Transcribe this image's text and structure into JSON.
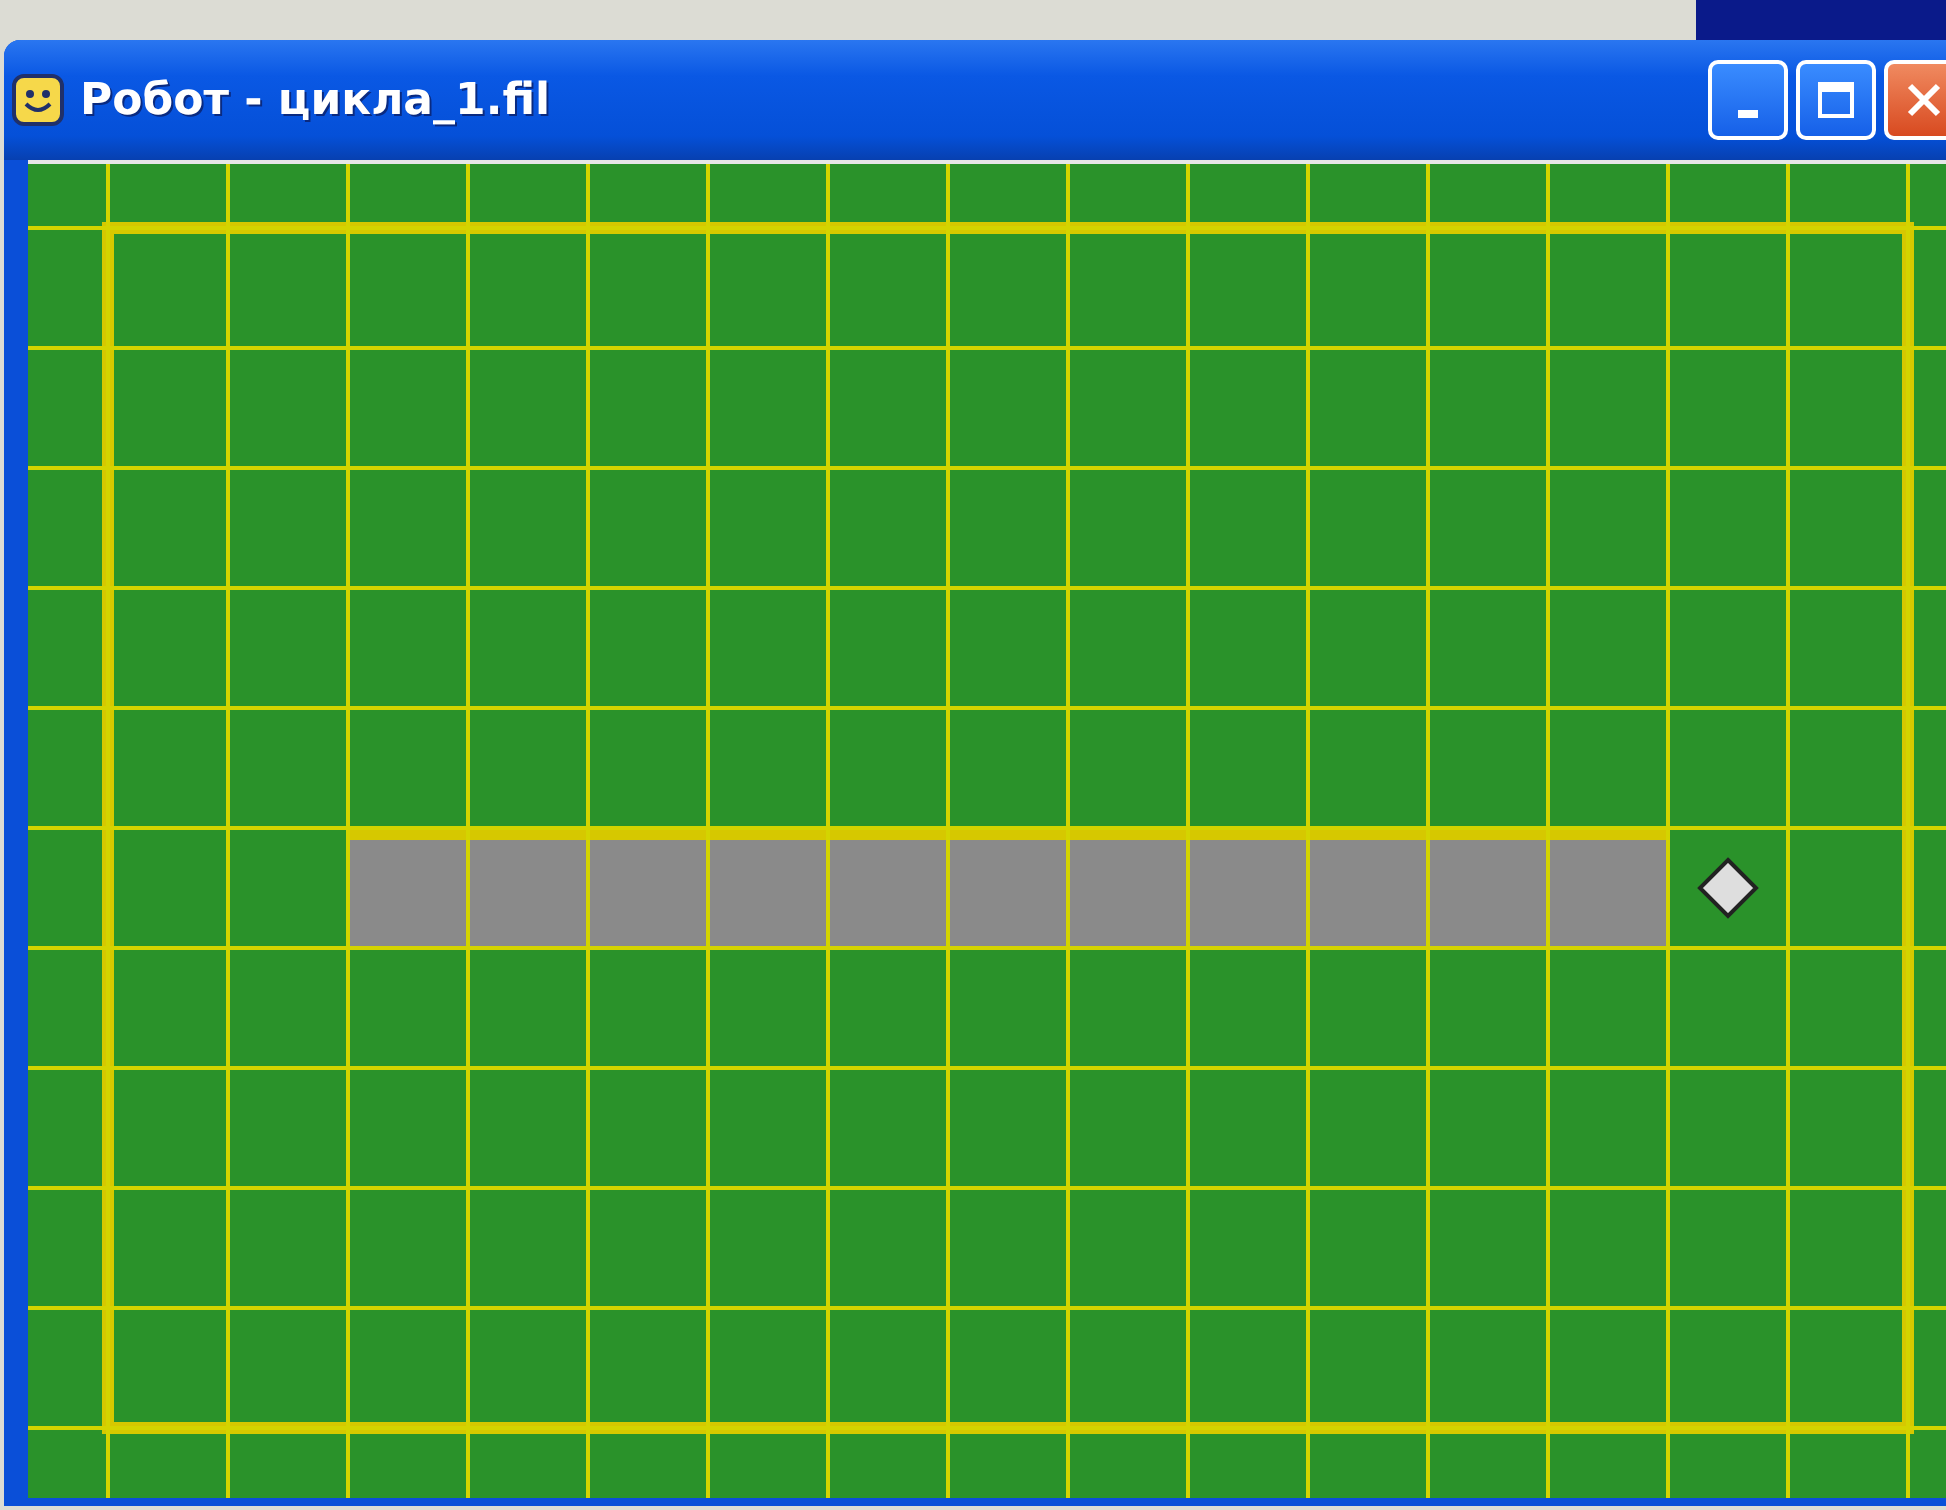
{
  "window": {
    "title": "Робот - цикла_1.fil",
    "buttons": [
      {
        "kind": "minimize"
      },
      {
        "kind": "maximize"
      },
      {
        "kind": "close"
      }
    ]
  },
  "field": {
    "rows": [
      {
        "cells": [
          {
            "painted": false,
            "robot": false,
            "wall_top": false
          },
          {
            "painted": false,
            "robot": false,
            "wall_top": false
          },
          {
            "painted": false,
            "robot": false,
            "wall_top": false
          },
          {
            "painted": false,
            "robot": false,
            "wall_top": false
          },
          {
            "painted": false,
            "robot": false,
            "wall_top": false
          },
          {
            "painted": false,
            "robot": false,
            "wall_top": false
          },
          {
            "painted": false,
            "robot": false,
            "wall_top": false
          },
          {
            "painted": false,
            "robot": false,
            "wall_top": false
          },
          {
            "painted": false,
            "robot": false,
            "wall_top": false
          },
          {
            "painted": false,
            "robot": false,
            "wall_top": false
          },
          {
            "painted": false,
            "robot": false,
            "wall_top": false
          },
          {
            "painted": false,
            "robot": false,
            "wall_top": false
          },
          {
            "painted": false,
            "robot": false,
            "wall_top": false
          },
          {
            "painted": false,
            "robot": false,
            "wall_top": false
          },
          {
            "painted": false,
            "robot": false,
            "wall_top": false
          }
        ]
      },
      {
        "cells": [
          {
            "painted": false,
            "robot": false,
            "wall_top": false
          },
          {
            "painted": false,
            "robot": false,
            "wall_top": false
          },
          {
            "painted": false,
            "robot": false,
            "wall_top": false
          },
          {
            "painted": false,
            "robot": false,
            "wall_top": false
          },
          {
            "painted": false,
            "robot": false,
            "wall_top": false
          },
          {
            "painted": false,
            "robot": false,
            "wall_top": false
          },
          {
            "painted": false,
            "robot": false,
            "wall_top": false
          },
          {
            "painted": false,
            "robot": false,
            "wall_top": false
          },
          {
            "painted": false,
            "robot": false,
            "wall_top": false
          },
          {
            "painted": false,
            "robot": false,
            "wall_top": false
          },
          {
            "painted": false,
            "robot": false,
            "wall_top": false
          },
          {
            "painted": false,
            "robot": false,
            "wall_top": false
          },
          {
            "painted": false,
            "robot": false,
            "wall_top": false
          },
          {
            "painted": false,
            "robot": false,
            "wall_top": false
          },
          {
            "painted": false,
            "robot": false,
            "wall_top": false
          }
        ]
      },
      {
        "cells": [
          {
            "painted": false,
            "robot": false,
            "wall_top": false
          },
          {
            "painted": false,
            "robot": false,
            "wall_top": false
          },
          {
            "painted": false,
            "robot": false,
            "wall_top": false
          },
          {
            "painted": false,
            "robot": false,
            "wall_top": false
          },
          {
            "painted": false,
            "robot": false,
            "wall_top": false
          },
          {
            "painted": false,
            "robot": false,
            "wall_top": false
          },
          {
            "painted": false,
            "robot": false,
            "wall_top": false
          },
          {
            "painted": false,
            "robot": false,
            "wall_top": false
          },
          {
            "painted": false,
            "robot": false,
            "wall_top": false
          },
          {
            "painted": false,
            "robot": false,
            "wall_top": false
          },
          {
            "painted": false,
            "robot": false,
            "wall_top": false
          },
          {
            "painted": false,
            "robot": false,
            "wall_top": false
          },
          {
            "painted": false,
            "robot": false,
            "wall_top": false
          },
          {
            "painted": false,
            "robot": false,
            "wall_top": false
          },
          {
            "painted": false,
            "robot": false,
            "wall_top": false
          }
        ]
      },
      {
        "cells": [
          {
            "painted": false,
            "robot": false,
            "wall_top": false
          },
          {
            "painted": false,
            "robot": false,
            "wall_top": false
          },
          {
            "painted": false,
            "robot": false,
            "wall_top": false
          },
          {
            "painted": false,
            "robot": false,
            "wall_top": false
          },
          {
            "painted": false,
            "robot": false,
            "wall_top": false
          },
          {
            "painted": false,
            "robot": false,
            "wall_top": false
          },
          {
            "painted": false,
            "robot": false,
            "wall_top": false
          },
          {
            "painted": false,
            "robot": false,
            "wall_top": false
          },
          {
            "painted": false,
            "robot": false,
            "wall_top": false
          },
          {
            "painted": false,
            "robot": false,
            "wall_top": false
          },
          {
            "painted": false,
            "robot": false,
            "wall_top": false
          },
          {
            "painted": false,
            "robot": false,
            "wall_top": false
          },
          {
            "painted": false,
            "robot": false,
            "wall_top": false
          },
          {
            "painted": false,
            "robot": false,
            "wall_top": false
          },
          {
            "painted": false,
            "robot": false,
            "wall_top": false
          }
        ]
      },
      {
        "cells": [
          {
            "painted": false,
            "robot": false,
            "wall_top": false
          },
          {
            "painted": false,
            "robot": false,
            "wall_top": false
          },
          {
            "painted": false,
            "robot": false,
            "wall_top": false
          },
          {
            "painted": false,
            "robot": false,
            "wall_top": false
          },
          {
            "painted": false,
            "robot": false,
            "wall_top": false
          },
          {
            "painted": false,
            "robot": false,
            "wall_top": false
          },
          {
            "painted": false,
            "robot": false,
            "wall_top": false
          },
          {
            "painted": false,
            "robot": false,
            "wall_top": false
          },
          {
            "painted": false,
            "robot": false,
            "wall_top": false
          },
          {
            "painted": false,
            "robot": false,
            "wall_top": false
          },
          {
            "painted": false,
            "robot": false,
            "wall_top": false
          },
          {
            "painted": false,
            "robot": false,
            "wall_top": false
          },
          {
            "painted": false,
            "robot": false,
            "wall_top": false
          },
          {
            "painted": false,
            "robot": false,
            "wall_top": false
          },
          {
            "painted": false,
            "robot": false,
            "wall_top": false
          }
        ]
      },
      {
        "cells": [
          {
            "painted": false,
            "robot": false,
            "wall_top": false
          },
          {
            "painted": false,
            "robot": false,
            "wall_top": false
          },
          {
            "painted": true,
            "robot": false,
            "wall_top": true
          },
          {
            "painted": true,
            "robot": false,
            "wall_top": true
          },
          {
            "painted": true,
            "robot": false,
            "wall_top": true
          },
          {
            "painted": true,
            "robot": false,
            "wall_top": true
          },
          {
            "painted": true,
            "robot": false,
            "wall_top": true
          },
          {
            "painted": true,
            "robot": false,
            "wall_top": true
          },
          {
            "painted": true,
            "robot": false,
            "wall_top": true
          },
          {
            "painted": true,
            "robot": false,
            "wall_top": true
          },
          {
            "painted": true,
            "robot": false,
            "wall_top": true
          },
          {
            "painted": true,
            "robot": false,
            "wall_top": true
          },
          {
            "painted": true,
            "robot": false,
            "wall_top": true
          },
          {
            "painted": false,
            "robot": true,
            "wall_top": false
          },
          {
            "painted": false,
            "robot": false,
            "wall_top": false
          }
        ]
      },
      {
        "cells": [
          {
            "painted": false,
            "robot": false,
            "wall_top": false
          },
          {
            "painted": false,
            "robot": false,
            "wall_top": false
          },
          {
            "painted": false,
            "robot": false,
            "wall_top": false
          },
          {
            "painted": false,
            "robot": false,
            "wall_top": false
          },
          {
            "painted": false,
            "robot": false,
            "wall_top": false
          },
          {
            "painted": false,
            "robot": false,
            "wall_top": false
          },
          {
            "painted": false,
            "robot": false,
            "wall_top": false
          },
          {
            "painted": false,
            "robot": false,
            "wall_top": false
          },
          {
            "painted": false,
            "robot": false,
            "wall_top": false
          },
          {
            "painted": false,
            "robot": false,
            "wall_top": false
          },
          {
            "painted": false,
            "robot": false,
            "wall_top": false
          },
          {
            "painted": false,
            "robot": false,
            "wall_top": false
          },
          {
            "painted": false,
            "robot": false,
            "wall_top": false
          },
          {
            "painted": false,
            "robot": false,
            "wall_top": false
          },
          {
            "painted": false,
            "robot": false,
            "wall_top": false
          }
        ]
      },
      {
        "cells": [
          {
            "painted": false,
            "robot": false,
            "wall_top": false
          },
          {
            "painted": false,
            "robot": false,
            "wall_top": false
          },
          {
            "painted": false,
            "robot": false,
            "wall_top": false
          },
          {
            "painted": false,
            "robot": false,
            "wall_top": false
          },
          {
            "painted": false,
            "robot": false,
            "wall_top": false
          },
          {
            "painted": false,
            "robot": false,
            "wall_top": false
          },
          {
            "painted": false,
            "robot": false,
            "wall_top": false
          },
          {
            "painted": false,
            "robot": false,
            "wall_top": false
          },
          {
            "painted": false,
            "robot": false,
            "wall_top": false
          },
          {
            "painted": false,
            "robot": false,
            "wall_top": false
          },
          {
            "painted": false,
            "robot": false,
            "wall_top": false
          },
          {
            "painted": false,
            "robot": false,
            "wall_top": false
          },
          {
            "painted": false,
            "robot": false,
            "wall_top": false
          },
          {
            "painted": false,
            "robot": false,
            "wall_top": false
          },
          {
            "painted": false,
            "robot": false,
            "wall_top": false
          }
        ]
      },
      {
        "cells": [
          {
            "painted": false,
            "robot": false,
            "wall_top": false
          },
          {
            "painted": false,
            "robot": false,
            "wall_top": false
          },
          {
            "painted": false,
            "robot": false,
            "wall_top": false
          },
          {
            "painted": false,
            "robot": false,
            "wall_top": false
          },
          {
            "painted": false,
            "robot": false,
            "wall_top": false
          },
          {
            "painted": false,
            "robot": false,
            "wall_top": false
          },
          {
            "painted": false,
            "robot": false,
            "wall_top": false
          },
          {
            "painted": false,
            "robot": false,
            "wall_top": false
          },
          {
            "painted": false,
            "robot": false,
            "wall_top": false
          },
          {
            "painted": false,
            "robot": false,
            "wall_top": false
          },
          {
            "painted": false,
            "robot": false,
            "wall_top": false
          },
          {
            "painted": false,
            "robot": false,
            "wall_top": false
          },
          {
            "painted": false,
            "robot": false,
            "wall_top": false
          },
          {
            "painted": false,
            "robot": false,
            "wall_top": false
          },
          {
            "painted": false,
            "robot": false,
            "wall_top": false
          }
        ]
      },
      {
        "cells": [
          {
            "painted": false,
            "robot": false,
            "wall_top": false
          },
          {
            "painted": false,
            "robot": false,
            "wall_top": false
          },
          {
            "painted": false,
            "robot": false,
            "wall_top": false
          },
          {
            "painted": false,
            "robot": false,
            "wall_top": false
          },
          {
            "painted": false,
            "robot": false,
            "wall_top": false
          },
          {
            "painted": false,
            "robot": false,
            "wall_top": false
          },
          {
            "painted": false,
            "robot": false,
            "wall_top": false
          },
          {
            "painted": false,
            "robot": false,
            "wall_top": false
          },
          {
            "painted": false,
            "robot": false,
            "wall_top": false
          },
          {
            "painted": false,
            "robot": false,
            "wall_top": false
          },
          {
            "painted": false,
            "robot": false,
            "wall_top": false
          },
          {
            "painted": false,
            "robot": false,
            "wall_top": false
          },
          {
            "painted": false,
            "robot": false,
            "wall_top": false
          },
          {
            "painted": false,
            "robot": false,
            "wall_top": false
          },
          {
            "painted": false,
            "robot": false,
            "wall_top": false
          }
        ]
      }
    ]
  }
}
